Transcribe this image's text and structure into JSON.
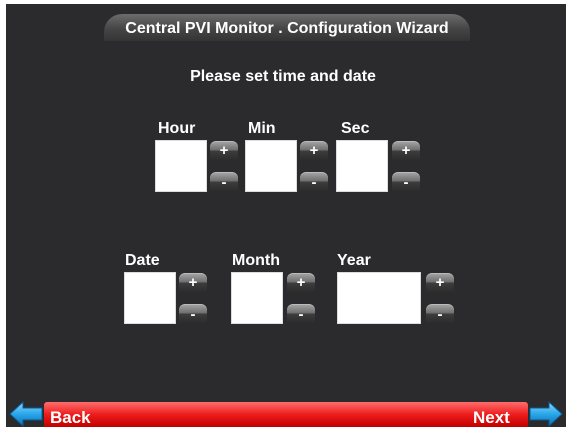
{
  "window": {
    "title": "Central PVI Monitor . Configuration Wizard"
  },
  "instruction": "Please set time and date",
  "time": {
    "hour_label": "Hour",
    "hour_value": "",
    "min_label": "Min",
    "min_value": "",
    "sec_label": "Sec",
    "sec_value": ""
  },
  "date": {
    "date_label": "Date",
    "date_value": "",
    "month_label": "Month",
    "month_value": "",
    "year_label": "Year",
    "year_value": ""
  },
  "stepper": {
    "plus": "+",
    "minus": "-"
  },
  "nav": {
    "back_label": "Back",
    "next_label": "Next"
  },
  "colors": {
    "background": "#2b2a2c",
    "nav_bar": "#ee1c1c",
    "arrow": "#2aa7e8",
    "text": "#ffffff"
  },
  "icons": {
    "back": "arrow-left-icon",
    "next": "arrow-right-icon"
  }
}
